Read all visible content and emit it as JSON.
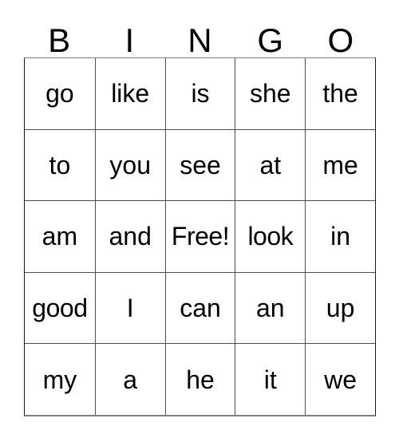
{
  "card": {
    "title": "BINGO",
    "headers": [
      "B",
      "I",
      "N",
      "G",
      "O"
    ],
    "free_space_label": "Free!",
    "rows": [
      [
        "go",
        "like",
        "is",
        "she",
        "the"
      ],
      [
        "to",
        "you",
        "see",
        "at",
        "me"
      ],
      [
        "am",
        "and",
        "Free!",
        "look",
        "in"
      ],
      [
        "good",
        "I",
        "can",
        "an",
        "up"
      ],
      [
        "my",
        "a",
        "he",
        "it",
        "we"
      ]
    ],
    "colors": {
      "background": "#ffffff",
      "text": "#000000",
      "grid_line": "#4d4d4d",
      "grid_border": "#808080"
    }
  }
}
